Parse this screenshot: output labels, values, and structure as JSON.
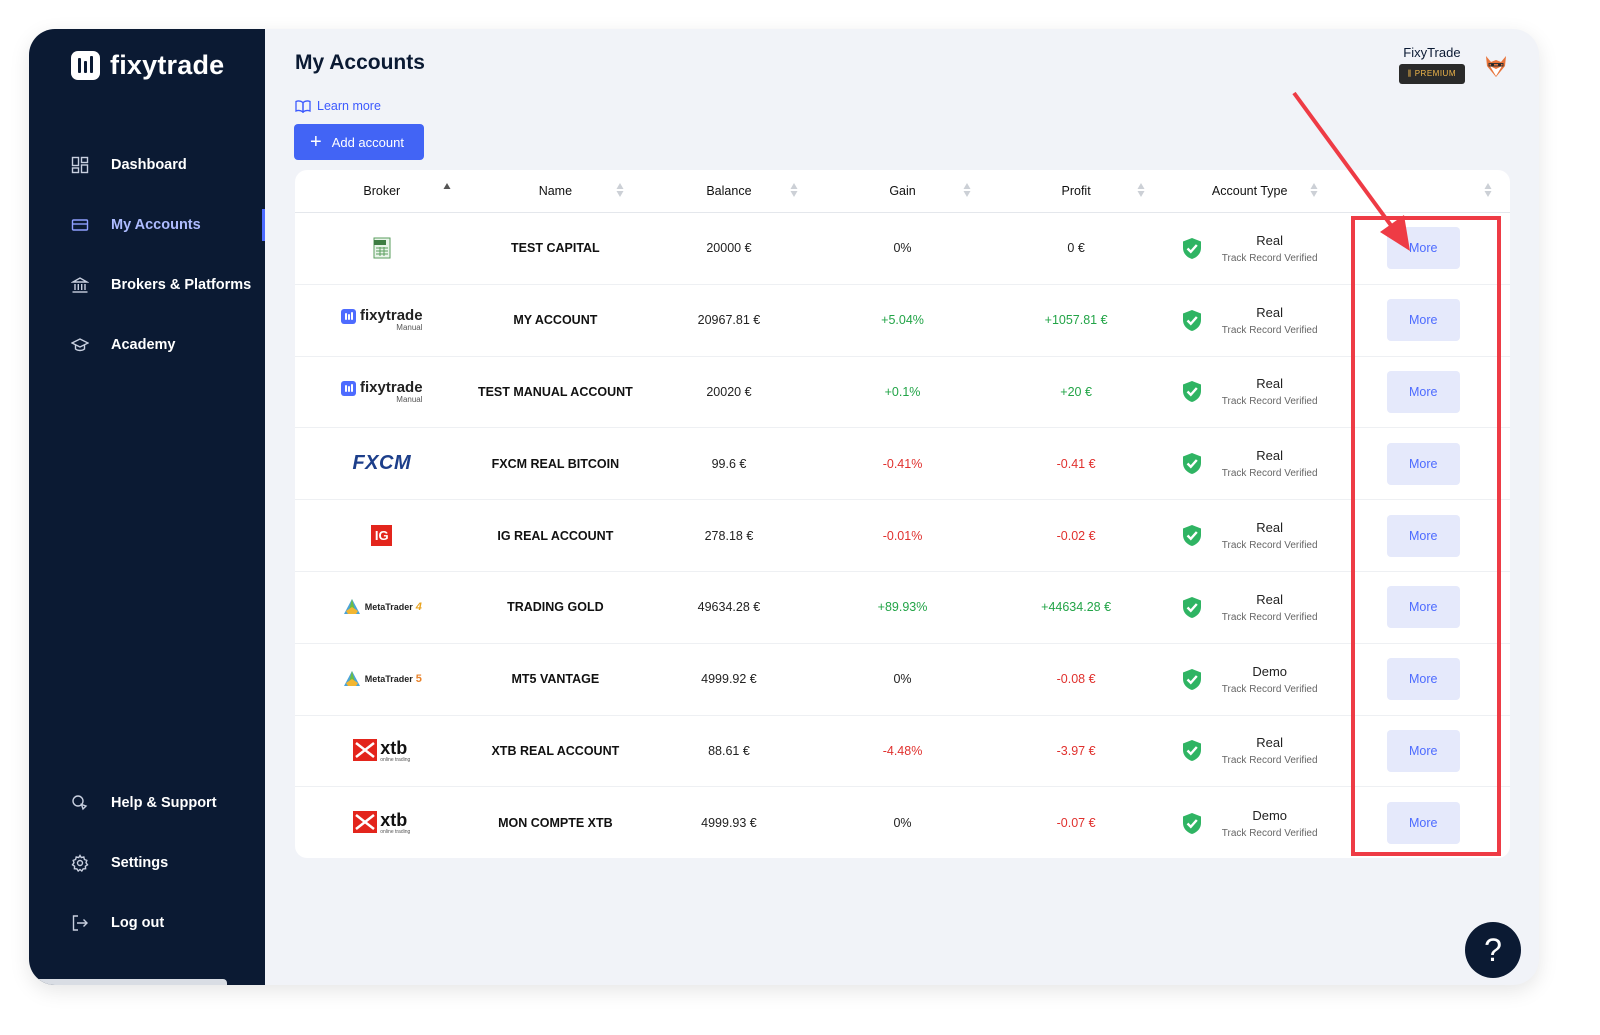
{
  "app": {
    "name": "fixytrade"
  },
  "sidebar": {
    "items": [
      {
        "label": "Dashboard",
        "icon": "dashboard-icon"
      },
      {
        "label": "My Accounts",
        "icon": "wallet-icon",
        "active": true
      },
      {
        "label": "Brokers & Platforms",
        "icon": "bank-icon"
      },
      {
        "label": "Academy",
        "icon": "graduation-cap-icon"
      }
    ],
    "bottom_items": [
      {
        "label": "Help & Support",
        "icon": "support-icon"
      },
      {
        "label": "Settings",
        "icon": "gear-icon"
      },
      {
        "label": "Log out",
        "icon": "logout-icon"
      }
    ]
  },
  "header": {
    "title": "My Accounts",
    "learn_more": "Learn more",
    "add_account": "Add account",
    "user_name": "FixyTrade",
    "badge": "PREMIUM"
  },
  "table": {
    "columns": [
      "Broker",
      "Name",
      "Balance",
      "Gain",
      "Profit",
      "Account Type",
      ""
    ],
    "sorted_column": "Broker",
    "more_label": "More",
    "rows": [
      {
        "broker": "csv",
        "broker_label": "CSV",
        "name": "TEST CAPITAL",
        "balance": "20000 €",
        "gain": "0%",
        "profit": "0 €",
        "gain_sign": "zero",
        "profit_sign": "zero",
        "type": "Real",
        "verified": "Track Record Verified"
      },
      {
        "broker": "fixytrade",
        "broker_label": "fixytrade",
        "broker_sub": "Manual",
        "name": "MY ACCOUNT",
        "balance": "20967.81 €",
        "gain": "+5.04%",
        "profit": "+1057.81 €",
        "gain_sign": "pos",
        "profit_sign": "pos",
        "type": "Real",
        "verified": "Track Record Verified"
      },
      {
        "broker": "fixytrade",
        "broker_label": "fixytrade",
        "broker_sub": "Manual",
        "name": "TEST MANUAL ACCOUNT",
        "balance": "20020 €",
        "gain": "+0.1%",
        "profit": "+20 €",
        "gain_sign": "pos",
        "profit_sign": "pos",
        "type": "Real",
        "verified": "Track Record Verified"
      },
      {
        "broker": "fxcm",
        "broker_label": "FXCM",
        "name": "FXCM REAL BITCOIN",
        "balance": "99.6 €",
        "gain": "-0.41%",
        "profit": "-0.41 €",
        "gain_sign": "neg",
        "profit_sign": "neg",
        "type": "Real",
        "verified": "Track Record Verified"
      },
      {
        "broker": "ig",
        "broker_label": "IG",
        "name": "IG REAL ACCOUNT",
        "balance": "278.18 €",
        "gain": "-0.01%",
        "profit": "-0.02 €",
        "gain_sign": "neg",
        "profit_sign": "neg",
        "type": "Real",
        "verified": "Track Record Verified"
      },
      {
        "broker": "mt4",
        "broker_label": "MetaTrader",
        "broker_num": "4",
        "name": "TRADING GOLD",
        "balance": "49634.28 €",
        "gain": "+89.93%",
        "profit": "+44634.28 €",
        "gain_sign": "pos",
        "profit_sign": "pos",
        "type": "Real",
        "verified": "Track Record Verified"
      },
      {
        "broker": "mt5",
        "broker_label": "MetaTrader",
        "broker_num": "5",
        "name": "MT5 VANTAGE",
        "balance": "4999.92 €",
        "gain": "0%",
        "profit": "-0.08 €",
        "gain_sign": "zero",
        "profit_sign": "neg",
        "type": "Demo",
        "verified": "Track Record Verified"
      },
      {
        "broker": "xtb",
        "broker_label": "xtb",
        "broker_sub": "online trading",
        "name": "XTB REAL ACCOUNT",
        "balance": "88.61 €",
        "gain": "-4.48%",
        "profit": "-3.97 €",
        "gain_sign": "neg",
        "profit_sign": "neg",
        "type": "Real",
        "verified": "Track Record Verified"
      },
      {
        "broker": "xtb",
        "broker_label": "xtb",
        "broker_sub": "online trading",
        "name": "MON COMPTE XTB",
        "balance": "4999.93 €",
        "gain": "0%",
        "profit": "-0.07 €",
        "gain_sign": "zero",
        "profit_sign": "neg",
        "type": "Demo",
        "verified": "Track Record Verified"
      }
    ]
  },
  "help_button": "?",
  "colors": {
    "sidebar_bg": "#0b1a33",
    "accent": "#4264f5",
    "positive": "#22a447",
    "negative": "#e0312e",
    "highlight": "#ee3b45"
  }
}
